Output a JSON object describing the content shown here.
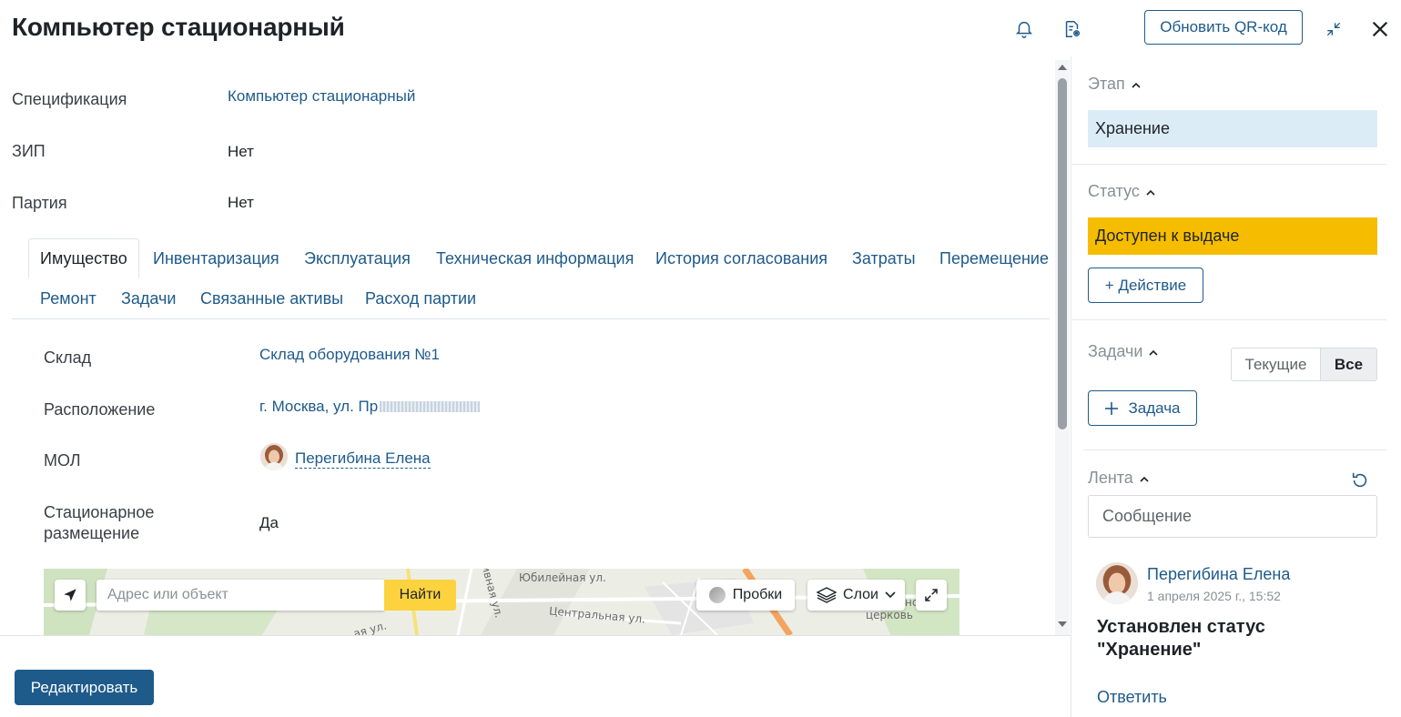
{
  "header": {
    "title": "Компьютер стационарный",
    "update_qr_label": "Обновить QR-код"
  },
  "fields": {
    "spec_label": "Спецификация",
    "spec_value": "Компьютер стационарный",
    "zip_label": "ЗИП",
    "zip_value": "Нет",
    "batch_label": "Партия",
    "batch_value": "Нет"
  },
  "tabs": [
    {
      "label": "Имущество"
    },
    {
      "label": "Инвентаризация"
    },
    {
      "label": "Эксплуатация"
    },
    {
      "label": "Техническая информация"
    },
    {
      "label": "История согласования"
    },
    {
      "label": "Затраты"
    },
    {
      "label": "Перемещение"
    },
    {
      "label": "Ремонт"
    },
    {
      "label": "Задачи"
    },
    {
      "label": "Связанные активы"
    },
    {
      "label": "Расход партии"
    }
  ],
  "property": {
    "warehouse_label": "Склад",
    "warehouse_value": "Склад оборудования №1",
    "location_label": "Расположение",
    "location_value": "г. Москва, ул. Пр",
    "mol_label": "МОЛ",
    "mol_value": "Перегибина Елена",
    "stationary_label_1": "Стационарное",
    "stationary_label_2": "размещение",
    "stationary_value": "Да"
  },
  "map": {
    "search_placeholder": "Адрес или объект",
    "find_label": "Найти",
    "traffic_label": "Пробки",
    "layers_label": "Слои",
    "streets": [
      "Юбилейная ул.",
      "Центральная ул.",
      "ивная ул.",
      "ая ул.",
      "церковь",
      "нс"
    ]
  },
  "footer": {
    "edit_label": "Редактировать"
  },
  "sidebar": {
    "stage_title": "Этап",
    "stage_value": "Хранение",
    "status_title": "Статус",
    "status_value": "Доступен к выдаче",
    "action_label": "+ Действие",
    "tasks_title": "Задачи",
    "tasks_current": "Текущие",
    "tasks_all": "Все",
    "add_task_label": "Задача",
    "feed_title": "Лента",
    "message_placeholder": "Сообщение",
    "post": {
      "author": "Перегибина Елена",
      "date": "1 апреля 2025 г., 15:52",
      "text_1": "Установлен статус",
      "text_2": "\"Хранение\"",
      "reply_label": "Ответить"
    }
  },
  "colors": {
    "accent": "#1e5a8a",
    "stage_bg": "#dcecf7",
    "status_bg": "#f6bd00",
    "find_bg": "#fcd33f"
  }
}
